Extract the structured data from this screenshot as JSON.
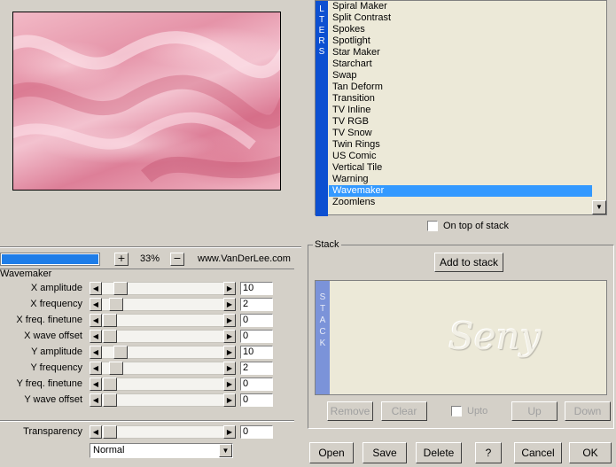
{
  "preview": {
    "zoom": "33%",
    "zoom_in": "+",
    "zoom_out": "−",
    "url": "www.VanDerLee.com",
    "progress": 1.0
  },
  "filter_panel": {
    "title": "Wavemaker",
    "params": [
      {
        "label": "X amplitude",
        "value": "10",
        "position": 0.1
      },
      {
        "label": "X frequency",
        "value": "2",
        "position": 0.06
      },
      {
        "label": "X freq. finetune",
        "value": "0",
        "position": 0.0
      },
      {
        "label": "X wave offset",
        "value": "0",
        "position": 0.0
      },
      {
        "label": "Y amplitude",
        "value": "10",
        "position": 0.1
      },
      {
        "label": "Y frequency",
        "value": "2",
        "position": 0.06
      },
      {
        "label": "Y freq. finetune",
        "value": "0",
        "position": 0.0
      },
      {
        "label": "Y wave offset",
        "value": "0",
        "position": 0.0
      }
    ],
    "transparency": {
      "label": "Transparency",
      "value": "0",
      "position": 0.0
    },
    "blend_mode": "Normal"
  },
  "filters_tab_letters": [
    "L",
    "T",
    "E",
    "R",
    "S"
  ],
  "filter_list": {
    "items": [
      "Spiral Maker",
      "Split Contrast",
      "Spokes",
      "Spotlight",
      "Star Maker",
      "Starchart",
      "Swap",
      "Tan Deform",
      "Transition",
      "TV Inline",
      "TV RGB",
      "TV Snow",
      "Twin Rings",
      "US Comic",
      "Vertical Tile",
      "Warning",
      "Wavemaker",
      "Zoomlens"
    ],
    "selected": "Wavemaker",
    "on_top_label": "On top of stack"
  },
  "stack": {
    "title": "Stack",
    "add_button": "Add to stack",
    "tab_letters": [
      "S",
      "T",
      "A",
      "C",
      "K"
    ],
    "watermark": "Seny",
    "remove": "Remove",
    "clear": "Clear",
    "upto": "Upto",
    "up": "Up",
    "down": "Down"
  },
  "footer": {
    "open": "Open",
    "save": "Save",
    "delete": "Delete",
    "help": "?",
    "cancel": "Cancel",
    "ok": "OK"
  },
  "icons": {
    "scroll_left": "left-arrow-icon",
    "scroll_right": "right-arrow-icon",
    "dropdown": "chevron-down-icon"
  },
  "colors": {
    "selection": "#3399ff",
    "filters_tab": "#0c4fd1",
    "stack_tab": "#7b93d9",
    "progress": "#1e7de8"
  }
}
